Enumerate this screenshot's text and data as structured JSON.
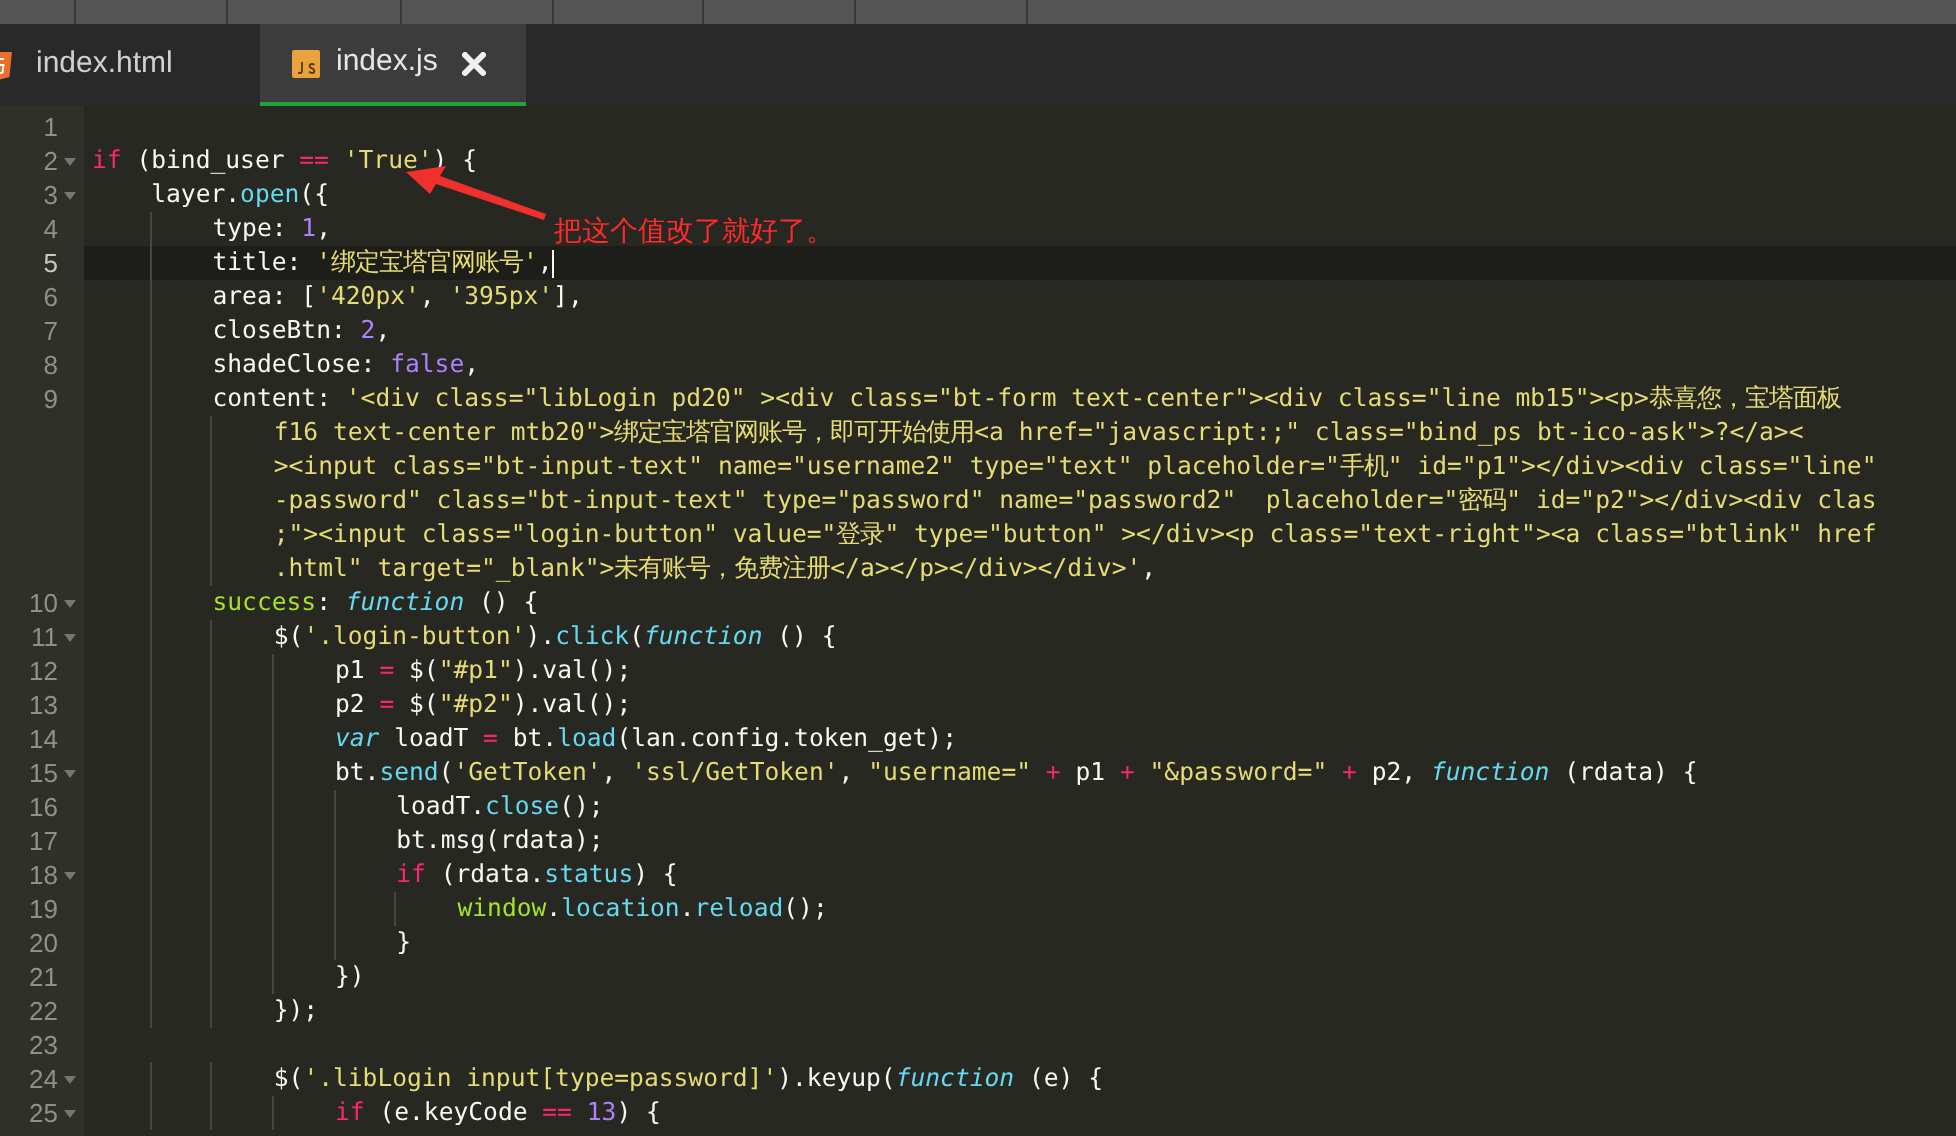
{
  "tabs": [
    {
      "label": "index.html",
      "kind": "html",
      "selected": false,
      "closable": false
    },
    {
      "label": "index.js",
      "kind": "js",
      "selected": true,
      "closable": true
    }
  ],
  "lines": [
    {
      "number": "1",
      "fold": false,
      "current": false,
      "rows": [
        []
      ]
    },
    {
      "number": "2",
      "fold": true,
      "current": false,
      "rows": [
        [
          {
            "kind": "keyword",
            "text": "if"
          },
          {
            "kind": "plain",
            "text": " (bind_user "
          },
          {
            "kind": "keyword",
            "text": "=="
          },
          {
            "kind": "plain",
            "text": " "
          },
          {
            "kind": "string",
            "text": "'True'"
          },
          {
            "kind": "plain",
            "text": ") {"
          }
        ]
      ]
    },
    {
      "number": "3",
      "fold": true,
      "current": false,
      "rows": [
        [
          {
            "kind": "plain",
            "text": "    layer."
          },
          {
            "kind": "method",
            "text": "open"
          },
          {
            "kind": "plain",
            "text": "({"
          }
        ]
      ]
    },
    {
      "number": "4",
      "fold": false,
      "current": false,
      "rows": [
        [
          {
            "kind": "plain",
            "text": "        type: "
          },
          {
            "kind": "number",
            "text": "1"
          },
          {
            "kind": "plain",
            "text": ","
          }
        ]
      ]
    },
    {
      "number": "5",
      "fold": false,
      "current": true,
      "rows": [
        [
          {
            "kind": "plain",
            "text": "        title: "
          },
          {
            "kind": "string",
            "text": "'绑定宝塔官网账号'"
          },
          {
            "kind": "plain",
            "text": ","
          }
        ]
      ]
    },
    {
      "number": "6",
      "fold": false,
      "current": false,
      "rows": [
        [
          {
            "kind": "plain",
            "text": "        area: ["
          },
          {
            "kind": "string",
            "text": "'420px'"
          },
          {
            "kind": "plain",
            "text": ", "
          },
          {
            "kind": "string",
            "text": "'395px'"
          },
          {
            "kind": "plain",
            "text": "],"
          }
        ]
      ]
    },
    {
      "number": "7",
      "fold": false,
      "current": false,
      "rows": [
        [
          {
            "kind": "plain",
            "text": "        closeBtn: "
          },
          {
            "kind": "number",
            "text": "2"
          },
          {
            "kind": "plain",
            "text": ","
          }
        ]
      ]
    },
    {
      "number": "8",
      "fold": false,
      "current": false,
      "rows": [
        [
          {
            "kind": "plain",
            "text": "        shadeClose: "
          },
          {
            "kind": "number",
            "text": "false"
          },
          {
            "kind": "plain",
            "text": ","
          }
        ]
      ]
    },
    {
      "number": "9",
      "fold": false,
      "current": false,
      "rows": [
        [
          {
            "kind": "plain",
            "text": "        content: "
          },
          {
            "kind": "string",
            "text": "'<div class=\"libLogin pd20\" ><div class=\"bt-form text-center\"><div class=\"line mb15\"><p>恭喜您，宝塔面板"
          }
        ],
        [
          {
            "kind": "string",
            "text": "            f16 text-center mtb20\">绑定宝塔官网账号，即可开始使用<a href=\"javascript:;\" class=\"bind_ps bt-ico-ask\">?</a><"
          }
        ],
        [
          {
            "kind": "string",
            "text": "            ><input class=\"bt-input-text\" name=\"username2\" type=\"text\" placeholder=\"手机\" id=\"p1\"></div><div class=\"line\""
          }
        ],
        [
          {
            "kind": "string",
            "text": "            -password\" class=\"bt-input-text\" type=\"password\" name=\"password2\"  placeholder=\"密码\" id=\"p2\"></div><div clas"
          }
        ],
        [
          {
            "kind": "string",
            "text": "            ;\"><input class=\"login-button\" value=\"登录\" type=\"button\" ></div><p class=\"text-right\"><a class=\"btlink\" href"
          }
        ],
        [
          {
            "kind": "string",
            "text": "            .html\" target=\"_blank\">未有账号，免费注册</a></p></div></div>'"
          },
          {
            "kind": "plain",
            "text": ","
          }
        ]
      ]
    },
    {
      "number": "10",
      "fold": true,
      "current": false,
      "rows": [
        [
          {
            "kind": "plain",
            "text": "        "
          },
          {
            "kind": "property",
            "text": "success"
          },
          {
            "kind": "plain",
            "text": ": "
          },
          {
            "kind": "storage",
            "text": "function"
          },
          {
            "kind": "plain",
            "text": " () {"
          }
        ]
      ]
    },
    {
      "number": "11",
      "fold": true,
      "current": false,
      "rows": [
        [
          {
            "kind": "plain",
            "text": "            $("
          },
          {
            "kind": "string",
            "text": "'.login-button'"
          },
          {
            "kind": "plain",
            "text": ")."
          },
          {
            "kind": "method",
            "text": "click"
          },
          {
            "kind": "plain",
            "text": "("
          },
          {
            "kind": "storage",
            "text": "function"
          },
          {
            "kind": "plain",
            "text": " () {"
          }
        ]
      ]
    },
    {
      "number": "12",
      "fold": false,
      "current": false,
      "rows": [
        [
          {
            "kind": "plain",
            "text": "                p1 "
          },
          {
            "kind": "keyword",
            "text": "="
          },
          {
            "kind": "plain",
            "text": " $("
          },
          {
            "kind": "string",
            "text": "\"#p1\""
          },
          {
            "kind": "plain",
            "text": ").val();"
          }
        ]
      ]
    },
    {
      "number": "13",
      "fold": false,
      "current": false,
      "rows": [
        [
          {
            "kind": "plain",
            "text": "                p2 "
          },
          {
            "kind": "keyword",
            "text": "="
          },
          {
            "kind": "plain",
            "text": " $("
          },
          {
            "kind": "string",
            "text": "\"#p2\""
          },
          {
            "kind": "plain",
            "text": ").val();"
          }
        ]
      ]
    },
    {
      "number": "14",
      "fold": false,
      "current": false,
      "rows": [
        [
          {
            "kind": "plain",
            "text": "                "
          },
          {
            "kind": "storage",
            "text": "var"
          },
          {
            "kind": "plain",
            "text": " loadT "
          },
          {
            "kind": "keyword",
            "text": "="
          },
          {
            "kind": "plain",
            "text": " bt."
          },
          {
            "kind": "method",
            "text": "load"
          },
          {
            "kind": "plain",
            "text": "(lan.config.token_get);"
          }
        ]
      ]
    },
    {
      "number": "15",
      "fold": true,
      "current": false,
      "rows": [
        [
          {
            "kind": "plain",
            "text": "                bt."
          },
          {
            "kind": "method",
            "text": "send"
          },
          {
            "kind": "plain",
            "text": "("
          },
          {
            "kind": "string",
            "text": "'GetToken'"
          },
          {
            "kind": "plain",
            "text": ", "
          },
          {
            "kind": "string",
            "text": "'ssl/GetToken'"
          },
          {
            "kind": "plain",
            "text": ", "
          },
          {
            "kind": "string",
            "text": "\"username=\""
          },
          {
            "kind": "plain",
            "text": " "
          },
          {
            "kind": "keyword",
            "text": "+"
          },
          {
            "kind": "plain",
            "text": " p1 "
          },
          {
            "kind": "keyword",
            "text": "+"
          },
          {
            "kind": "plain",
            "text": " "
          },
          {
            "kind": "string",
            "text": "\"&password=\""
          },
          {
            "kind": "plain",
            "text": " "
          },
          {
            "kind": "keyword",
            "text": "+"
          },
          {
            "kind": "plain",
            "text": " p2, "
          },
          {
            "kind": "storage",
            "text": "function"
          },
          {
            "kind": "plain",
            "text": " (rdata) {"
          }
        ]
      ]
    },
    {
      "number": "16",
      "fold": false,
      "current": false,
      "rows": [
        [
          {
            "kind": "plain",
            "text": "                    loadT."
          },
          {
            "kind": "method",
            "text": "close"
          },
          {
            "kind": "plain",
            "text": "();"
          }
        ]
      ]
    },
    {
      "number": "17",
      "fold": false,
      "current": false,
      "rows": [
        [
          {
            "kind": "plain",
            "text": "                    bt.msg(rdata);"
          }
        ]
      ]
    },
    {
      "number": "18",
      "fold": true,
      "current": false,
      "rows": [
        [
          {
            "kind": "plain",
            "text": "                    "
          },
          {
            "kind": "keyword",
            "text": "if"
          },
          {
            "kind": "plain",
            "text": " (rdata."
          },
          {
            "kind": "method",
            "text": "status"
          },
          {
            "kind": "plain",
            "text": ") {"
          }
        ]
      ]
    },
    {
      "number": "19",
      "fold": false,
      "current": false,
      "rows": [
        [
          {
            "kind": "plain",
            "text": "                        "
          },
          {
            "kind": "property",
            "text": "window"
          },
          {
            "kind": "plain",
            "text": "."
          },
          {
            "kind": "method",
            "text": "location"
          },
          {
            "kind": "plain",
            "text": "."
          },
          {
            "kind": "method",
            "text": "reload"
          },
          {
            "kind": "plain",
            "text": "();"
          }
        ]
      ]
    },
    {
      "number": "20",
      "fold": false,
      "current": false,
      "rows": [
        [
          {
            "kind": "plain",
            "text": "                    }"
          }
        ]
      ]
    },
    {
      "number": "21",
      "fold": false,
      "current": false,
      "rows": [
        [
          {
            "kind": "plain",
            "text": "                })"
          }
        ]
      ]
    },
    {
      "number": "22",
      "fold": false,
      "current": false,
      "rows": [
        [
          {
            "kind": "plain",
            "text": "            });"
          }
        ]
      ]
    },
    {
      "number": "23",
      "fold": false,
      "current": false,
      "rows": [
        []
      ]
    },
    {
      "number": "24",
      "fold": true,
      "current": false,
      "rows": [
        [
          {
            "kind": "plain",
            "text": "            $("
          },
          {
            "kind": "string",
            "text": "'.libLogin input[type=password]'"
          },
          {
            "kind": "plain",
            "text": ").keyup("
          },
          {
            "kind": "storage",
            "text": "function"
          },
          {
            "kind": "plain",
            "text": " (e) {"
          }
        ]
      ]
    },
    {
      "number": "25",
      "fold": true,
      "current": false,
      "rows": [
        [
          {
            "kind": "plain",
            "text": "                "
          },
          {
            "kind": "keyword",
            "text": "if"
          },
          {
            "kind": "plain",
            "text": " (e.keyCode "
          },
          {
            "kind": "keyword",
            "text": "=="
          },
          {
            "kind": "plain",
            "text": " "
          },
          {
            "kind": "number",
            "text": "13"
          },
          {
            "kind": "plain",
            "text": ") {"
          }
        ]
      ]
    }
  ],
  "annotation": {
    "text": "把这个值改了就好了。"
  }
}
